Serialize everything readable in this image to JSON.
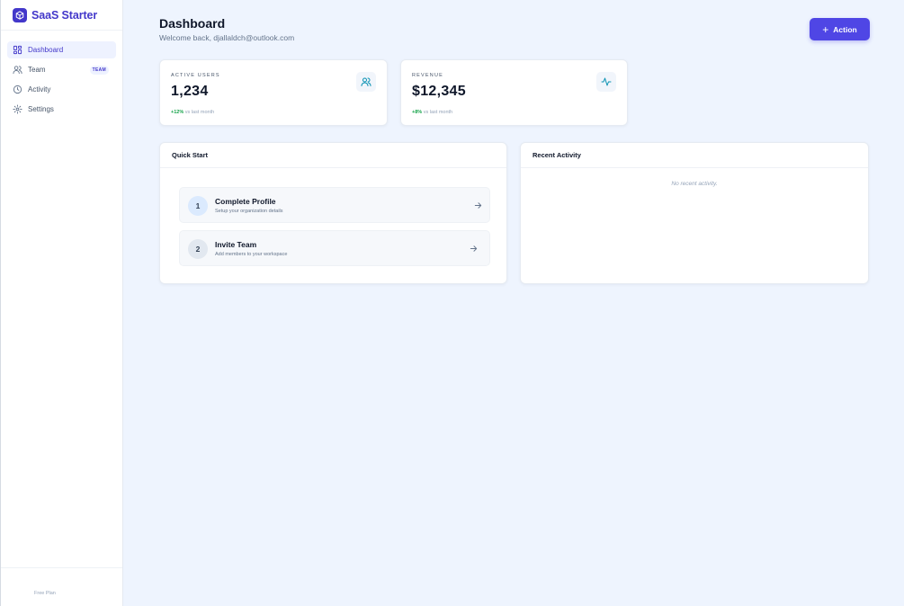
{
  "app": {
    "name": "SaaS Starter",
    "brand_color": "#4338ca"
  },
  "sidebar": {
    "items": [
      {
        "label": "Dashboard",
        "icon": "dashboard-icon",
        "active": true
      },
      {
        "label": "Team",
        "icon": "users-icon",
        "badge": "TEAM"
      },
      {
        "label": "Activity",
        "icon": "clock-icon"
      },
      {
        "label": "Settings",
        "icon": "gear-icon"
      }
    ],
    "footer_plan": "Free Plan"
  },
  "header": {
    "title": "Dashboard",
    "subtitle": "Welcome back, djallaldch@outlook.com",
    "action_label": "Action",
    "action_icon": "plus-icon",
    "accent": "#4f46e5"
  },
  "stats": [
    {
      "label": "ACTIVE USERS",
      "value": "1,234",
      "change": "+12%",
      "change_suffix": "vs last month",
      "icon": "users-icon"
    },
    {
      "label": "REVENUE",
      "value": "$12,345",
      "change": "+8%",
      "change_suffix": "vs last month",
      "icon": "activity-icon"
    }
  ],
  "quick_start": {
    "title": "Quick Start",
    "steps": [
      {
        "number": "1",
        "title": "Complete Profile",
        "description": "Setup your organization details",
        "icon": "arrow-right-icon"
      },
      {
        "number": "2",
        "title": "Invite Team",
        "description": "Add members to your workspace",
        "icon": "arrow-right-icon"
      }
    ]
  },
  "recent_activity": {
    "title": "Recent Activity",
    "empty_text": "No recent activity."
  }
}
